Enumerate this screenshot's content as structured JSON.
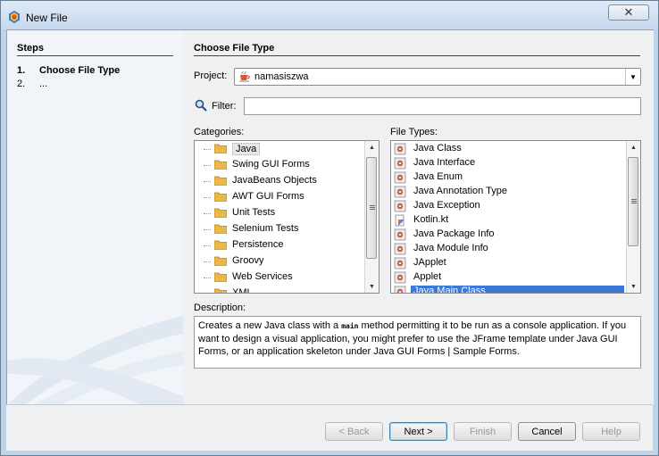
{
  "window": {
    "title": "New File",
    "close_label": "✕"
  },
  "steps": {
    "heading": "Steps",
    "items": [
      {
        "num": "1.",
        "label": "Choose File Type"
      },
      {
        "num": "2.",
        "label": "..."
      }
    ]
  },
  "main": {
    "heading": "Choose File Type",
    "project_label": "Project:",
    "project_value": "namasiszwa",
    "filter_label": "Filter:",
    "filter_value": "",
    "categories_label": "Categories:",
    "file_types_label": "File Types:",
    "categories": [
      "Java",
      "Swing GUI Forms",
      "JavaBeans Objects",
      "AWT GUI Forms",
      "Unit Tests",
      "Selenium Tests",
      "Persistence",
      "Groovy",
      "Web Services",
      "XML"
    ],
    "file_types": [
      "Java Class",
      "Java Interface",
      "Java Enum",
      "Java Annotation Type",
      "Java Exception",
      "Kotlin.kt",
      "Java Package Info",
      "Java Module Info",
      "JApplet",
      "Applet",
      "Java Main Class"
    ],
    "selected_category": "Java",
    "selected_file_type": "Java Main Class",
    "description_label": "Description:",
    "description_before": "Creates a new Java class with a ",
    "description_code": "main",
    "description_after": " method permitting it to be run as a console application. If you want to design a visual application, you might prefer to use the JFrame template under Java GUI Forms, or an application skeleton under Java GUI Forms | Sample Forms."
  },
  "buttons": {
    "back": "< Back",
    "next": "Next >",
    "finish": "Finish",
    "cancel": "Cancel",
    "help": "Help"
  },
  "colors": {
    "selection": "#3b78d8",
    "folder": "#e8b84a",
    "title_bar": "#c7d9ee"
  },
  "icons": [
    "netbeans-logo-icon",
    "close-icon",
    "coffee-cup-icon",
    "search-icon",
    "folder-icon",
    "java-class-file-icon",
    "kotlin-file-icon"
  ]
}
